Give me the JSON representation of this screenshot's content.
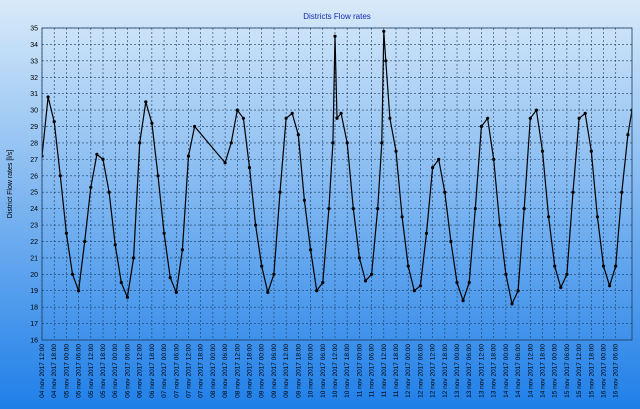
{
  "chart_data": {
    "type": "line",
    "title": "Districts Flow rates",
    "ylabel": "District Flow rates [l/s]",
    "xlabel": "",
    "ylim": [
      16,
      35
    ],
    "yticks": [
      16,
      17,
      18,
      19,
      20,
      21,
      22,
      23,
      24,
      25,
      26,
      27,
      28,
      29,
      30,
      31,
      32,
      33,
      34,
      35
    ],
    "grid": true,
    "legend": "none",
    "x_range": [
      "04 nov 2017 12:00",
      "16 nov 2017 14:00"
    ],
    "xticks": [
      "04 nov 2017 12:00",
      "04 nov 2017 18:00",
      "05 nov 2017 00:00",
      "05 nov 2017 06:00",
      "05 nov 2017 12:00",
      "05 nov 2017 18:00",
      "06 nov 2017 00:00",
      "06 nov 2017 06:00",
      "06 nov 2017 12:00",
      "06 nov 2017 18:00",
      "07 nov 2017 00:00",
      "07 nov 2017 06:00",
      "07 nov 2017 12:00",
      "07 nov 2017 18:00",
      "08 nov 2017 00:00",
      "08 nov 2017 06:00",
      "08 nov 2017 12:00",
      "08 nov 2017 18:00",
      "09 nov 2017 00:00",
      "09 nov 2017 06:00",
      "09 nov 2017 12:00",
      "09 nov 2017 18:00",
      "10 nov 2017 00:00",
      "10 nov 2017 06:00",
      "10 nov 2017 12:00",
      "10 nov 2017 18:00",
      "11 nov 2017 00:00",
      "11 nov 2017 06:00",
      "11 nov 2017 12:00",
      "11 nov 2017 18:00",
      "12 nov 2017 00:00",
      "12 nov 2017 06:00",
      "12 nov 2017 12:00",
      "12 nov 2017 18:00",
      "13 nov 2017 00:00",
      "13 nov 2017 06:00",
      "13 nov 2017 12:00",
      "13 nov 2017 18:00",
      "14 nov 2017 00:00",
      "14 nov 2017 06:00",
      "14 nov 2017 12:00",
      "14 nov 2017 18:00",
      "15 nov 2017 00:00",
      "15 nov 2017 06:00",
      "15 nov 2017 12:00",
      "15 nov 2017 18:00",
      "16 nov 2017 00:00",
      "16 nov 2017 06:00"
    ],
    "series": [
      {
        "values_format": "[time, flow_l_s]",
        "points": [
          [
            "04 nov 2017 12:00",
            27.2
          ],
          [
            "04 nov 2017 15:00",
            30.8
          ],
          [
            "04 nov 2017 18:00",
            29.3
          ],
          [
            "04 nov 2017 21:00",
            26.0
          ],
          [
            "05 nov 2017 00:00",
            22.5
          ],
          [
            "05 nov 2017 03:00",
            20.0
          ],
          [
            "05 nov 2017 06:00",
            19.0
          ],
          [
            "05 nov 2017 09:00",
            22.0
          ],
          [
            "05 nov 2017 12:00",
            25.3
          ],
          [
            "05 nov 2017 15:00",
            27.3
          ],
          [
            "05 nov 2017 18:00",
            27.0
          ],
          [
            "05 nov 2017 21:00",
            25.0
          ],
          [
            "06 nov 2017 00:00",
            21.8
          ],
          [
            "06 nov 2017 03:00",
            19.5
          ],
          [
            "06 nov 2017 06:00",
            18.6
          ],
          [
            "06 nov 2017 09:00",
            21.0
          ],
          [
            "06 nov 2017 12:00",
            28.0
          ],
          [
            "06 nov 2017 15:00",
            30.5
          ],
          [
            "06 nov 2017 18:00",
            29.2
          ],
          [
            "06 nov 2017 21:00",
            26.0
          ],
          [
            "07 nov 2017 00:00",
            22.5
          ],
          [
            "07 nov 2017 03:00",
            19.8
          ],
          [
            "07 nov 2017 06:00",
            18.9
          ],
          [
            "07 nov 2017 09:00",
            21.5
          ],
          [
            "07 nov 2017 12:00",
            27.2
          ],
          [
            "07 nov 2017 15:00",
            29.0
          ],
          [
            "08 nov 2017 06:00",
            26.8
          ],
          [
            "08 nov 2017 09:00",
            28.0
          ],
          [
            "08 nov 2017 12:00",
            30.0
          ],
          [
            "08 nov 2017 15:00",
            29.5
          ],
          [
            "08 nov 2017 18:00",
            26.5
          ],
          [
            "08 nov 2017 21:00",
            23.0
          ],
          [
            "09 nov 2017 00:00",
            20.5
          ],
          [
            "09 nov 2017 03:00",
            18.9
          ],
          [
            "09 nov 2017 06:00",
            20.0
          ],
          [
            "09 nov 2017 09:00",
            25.0
          ],
          [
            "09 nov 2017 12:00",
            29.5
          ],
          [
            "09 nov 2017 15:00",
            29.8
          ],
          [
            "09 nov 2017 18:00",
            28.5
          ],
          [
            "09 nov 2017 21:00",
            24.5
          ],
          [
            "10 nov 2017 00:00",
            21.5
          ],
          [
            "10 nov 2017 03:00",
            19.0
          ],
          [
            "10 nov 2017 06:00",
            19.5
          ],
          [
            "10 nov 2017 09:00",
            24.0
          ],
          [
            "10 nov 2017 11:00",
            28.0
          ],
          [
            "10 nov 2017 12:00",
            34.5
          ],
          [
            "10 nov 2017 13:00",
            29.5
          ],
          [
            "10 nov 2017 15:00",
            29.8
          ],
          [
            "10 nov 2017 18:00",
            28.0
          ],
          [
            "10 nov 2017 21:00",
            24.0
          ],
          [
            "11 nov 2017 00:00",
            21.0
          ],
          [
            "11 nov 2017 03:00",
            19.6
          ],
          [
            "11 nov 2017 06:00",
            20.0
          ],
          [
            "11 nov 2017 09:00",
            24.0
          ],
          [
            "11 nov 2017 11:00",
            28.0
          ],
          [
            "11 nov 2017 12:00",
            34.8
          ],
          [
            "11 nov 2017 13:00",
            33.0
          ],
          [
            "11 nov 2017 15:00",
            29.5
          ],
          [
            "11 nov 2017 18:00",
            27.5
          ],
          [
            "11 nov 2017 21:00",
            23.5
          ],
          [
            "12 nov 2017 00:00",
            20.5
          ],
          [
            "12 nov 2017 03:00",
            19.0
          ],
          [
            "12 nov 2017 06:00",
            19.3
          ],
          [
            "12 nov 2017 09:00",
            22.5
          ],
          [
            "12 nov 2017 12:00",
            26.5
          ],
          [
            "12 nov 2017 15:00",
            27.0
          ],
          [
            "12 nov 2017 18:00",
            25.0
          ],
          [
            "12 nov 2017 21:00",
            22.0
          ],
          [
            "13 nov 2017 00:00",
            19.5
          ],
          [
            "13 nov 2017 03:00",
            18.4
          ],
          [
            "13 nov 2017 06:00",
            19.5
          ],
          [
            "13 nov 2017 09:00",
            24.0
          ],
          [
            "13 nov 2017 12:00",
            29.0
          ],
          [
            "13 nov 2017 15:00",
            29.5
          ],
          [
            "13 nov 2017 18:00",
            27.0
          ],
          [
            "13 nov 2017 21:00",
            23.0
          ],
          [
            "14 nov 2017 00:00",
            20.0
          ],
          [
            "14 nov 2017 03:00",
            18.2
          ],
          [
            "14 nov 2017 06:00",
            19.0
          ],
          [
            "14 nov 2017 09:00",
            24.0
          ],
          [
            "14 nov 2017 12:00",
            29.5
          ],
          [
            "14 nov 2017 15:00",
            30.0
          ],
          [
            "14 nov 2017 18:00",
            27.5
          ],
          [
            "14 nov 2017 21:00",
            23.5
          ],
          [
            "15 nov 2017 00:00",
            20.5
          ],
          [
            "15 nov 2017 03:00",
            19.2
          ],
          [
            "15 nov 2017 06:00",
            20.0
          ],
          [
            "15 nov 2017 09:00",
            25.0
          ],
          [
            "15 nov 2017 12:00",
            29.5
          ],
          [
            "15 nov 2017 15:00",
            29.8
          ],
          [
            "15 nov 2017 18:00",
            27.5
          ],
          [
            "15 nov 2017 21:00",
            23.5
          ],
          [
            "16 nov 2017 00:00",
            20.5
          ],
          [
            "16 nov 2017 03:00",
            19.3
          ],
          [
            "16 nov 2017 06:00",
            20.5
          ],
          [
            "16 nov 2017 09:00",
            25.0
          ],
          [
            "16 nov 2017 12:00",
            28.5
          ],
          [
            "16 nov 2017 14:00",
            30.0
          ]
        ]
      }
    ]
  },
  "colors": {
    "background_top": "#d8eaf9",
    "background_bottom": "#1f7fe8",
    "grid": "#1d3d5e",
    "series": "#000000",
    "axis_text": "#000000",
    "title": "#1a2bb0"
  }
}
